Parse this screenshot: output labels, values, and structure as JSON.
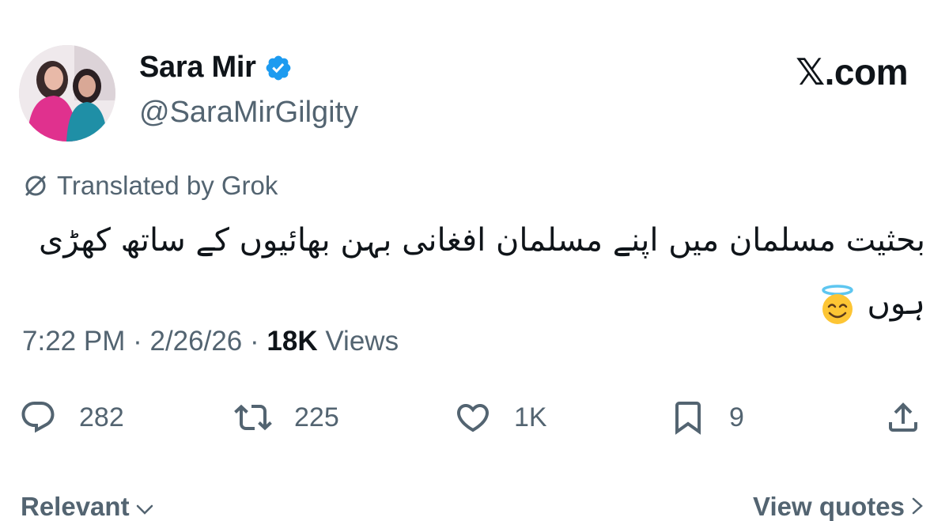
{
  "author": {
    "display_name": "Sara Mir",
    "handle": "@SaraMirGilgity",
    "verified": true
  },
  "brand": {
    "label": "𝕏.com"
  },
  "translation": {
    "label": "Translated by Grok",
    "icon": "translate-slash-icon"
  },
  "tweet": {
    "text": "بحثیت مسلمان میں اپنے مسلمان افغانی بہن بھائیوں کے ساتھ کھڑی ہوں",
    "emoji": "smiling-face-with-halo"
  },
  "meta": {
    "time": "7:22 PM",
    "separator": "·",
    "date": "2/26/26",
    "views_count": "18K",
    "views_label": "Views"
  },
  "actions": {
    "reply": {
      "icon": "reply-icon",
      "count": "282"
    },
    "retweet": {
      "icon": "retweet-icon",
      "count": "225"
    },
    "like": {
      "icon": "heart-icon",
      "count": "1K"
    },
    "bookmark": {
      "icon": "bookmark-icon",
      "count": "9"
    },
    "share": {
      "icon": "share-icon"
    }
  },
  "footer": {
    "sort_label": "Relevant",
    "view_quotes_label": "View quotes"
  },
  "colors": {
    "text_primary": "#0f1419",
    "text_secondary": "#536471",
    "verified_blue": "#1d9bf0"
  }
}
